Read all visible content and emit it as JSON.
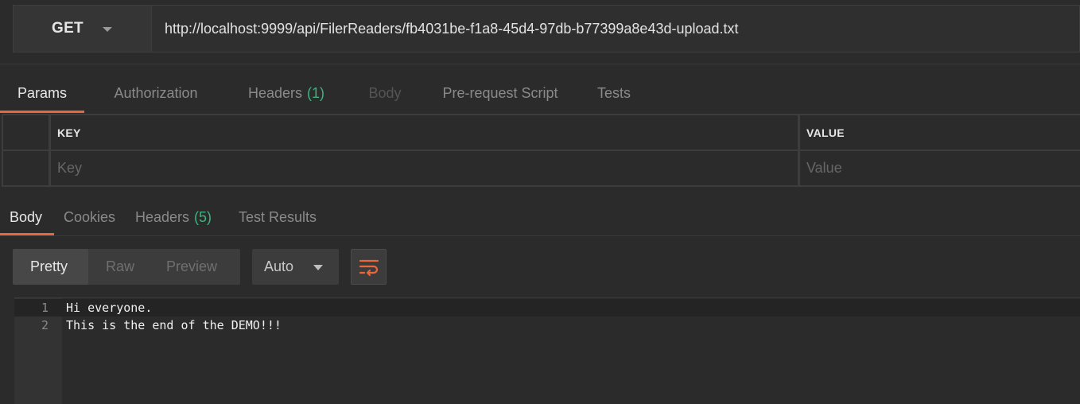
{
  "request": {
    "method": "GET",
    "url": "http://localhost:9999/api/FilerReaders/fb4031be-f1a8-45d4-97db-b77399a8e43d-upload.txt"
  },
  "request_tabs": [
    {
      "label": "Params",
      "count": "",
      "state": "active"
    },
    {
      "label": "Authorization",
      "count": "",
      "state": "normal"
    },
    {
      "label": "Headers",
      "count": "(1)",
      "state": "normal"
    },
    {
      "label": "Body",
      "count": "",
      "state": "disabled"
    },
    {
      "label": "Pre-request Script",
      "count": "",
      "state": "normal"
    },
    {
      "label": "Tests",
      "count": "",
      "state": "normal"
    }
  ],
  "params_table": {
    "key_header": "KEY",
    "value_header": "VALUE",
    "key_placeholder": "Key",
    "value_placeholder": "Value"
  },
  "response_tabs": [
    {
      "label": "Body",
      "count": "",
      "state": "active"
    },
    {
      "label": "Cookies",
      "count": "",
      "state": "normal"
    },
    {
      "label": "Headers",
      "count": "(5)",
      "state": "normal"
    },
    {
      "label": "Test Results",
      "count": "",
      "state": "normal"
    }
  ],
  "view_modes": {
    "pretty": "Pretty",
    "raw": "Raw",
    "preview": "Preview",
    "active": "Pretty"
  },
  "format": "Auto",
  "wrap_icon": "wrap-lines-icon",
  "response_body": [
    {
      "number": "1",
      "text": "Hi everyone."
    },
    {
      "number": "2",
      "text": "This is the end of the DEMO!!!"
    }
  ],
  "colors": {
    "accent": "#e8673b",
    "count": "#3fb27f",
    "background": "#2b2b2b"
  }
}
